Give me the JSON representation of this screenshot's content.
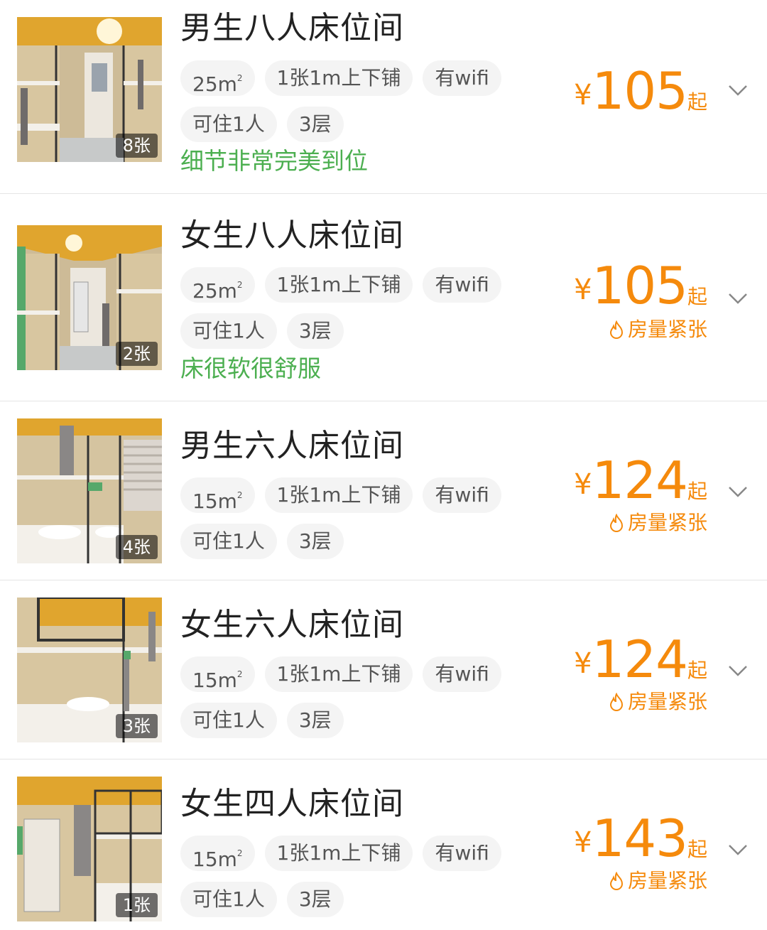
{
  "rooms": [
    {
      "name": "男生八人床位间",
      "photo_count": "8张",
      "tags": [
        "25m",
        "1张1m上下铺",
        "有wifi"
      ],
      "tags2": [
        "可住1人",
        "3层"
      ],
      "area_unit_sup": "2",
      "review": "细节非常完美到位",
      "currency": "¥",
      "price": "105",
      "price_suffix": "起",
      "scarcity": ""
    },
    {
      "name": "女生八人床位间",
      "photo_count": "2张",
      "tags": [
        "25m",
        "1张1m上下铺",
        "有wifi"
      ],
      "tags2": [
        "可住1人",
        "3层"
      ],
      "area_unit_sup": "2",
      "review": "床很软很舒服",
      "currency": "¥",
      "price": "105",
      "price_suffix": "起",
      "scarcity": "房量紧张"
    },
    {
      "name": "男生六人床位间",
      "photo_count": "4张",
      "tags": [
        "15m",
        "1张1m上下铺",
        "有wifi"
      ],
      "tags2": [
        "可住1人",
        "3层"
      ],
      "area_unit_sup": "2",
      "review": "",
      "currency": "¥",
      "price": "124",
      "price_suffix": "起",
      "scarcity": "房量紧张"
    },
    {
      "name": "女生六人床位间",
      "photo_count": "3张",
      "tags": [
        "15m",
        "1张1m上下铺",
        "有wifi"
      ],
      "tags2": [
        "可住1人",
        "3层"
      ],
      "area_unit_sup": "2",
      "review": "",
      "currency": "¥",
      "price": "124",
      "price_suffix": "起",
      "scarcity": "房量紧张"
    },
    {
      "name": "女生四人床位间",
      "photo_count": "1张",
      "tags": [
        "15m",
        "1张1m上下铺",
        "有wifi"
      ],
      "tags2": [
        "可住1人",
        "3层"
      ],
      "area_unit_sup": "2",
      "review": "",
      "currency": "¥",
      "price": "143",
      "price_suffix": "起",
      "scarcity": "房量紧张"
    }
  ],
  "colors": {
    "price": "#f58a0c",
    "review": "#4caf50",
    "tag_bg": "#f4f4f4"
  },
  "icons": {
    "scarcity": "flame-icon",
    "expand": "chevron-down-icon"
  }
}
